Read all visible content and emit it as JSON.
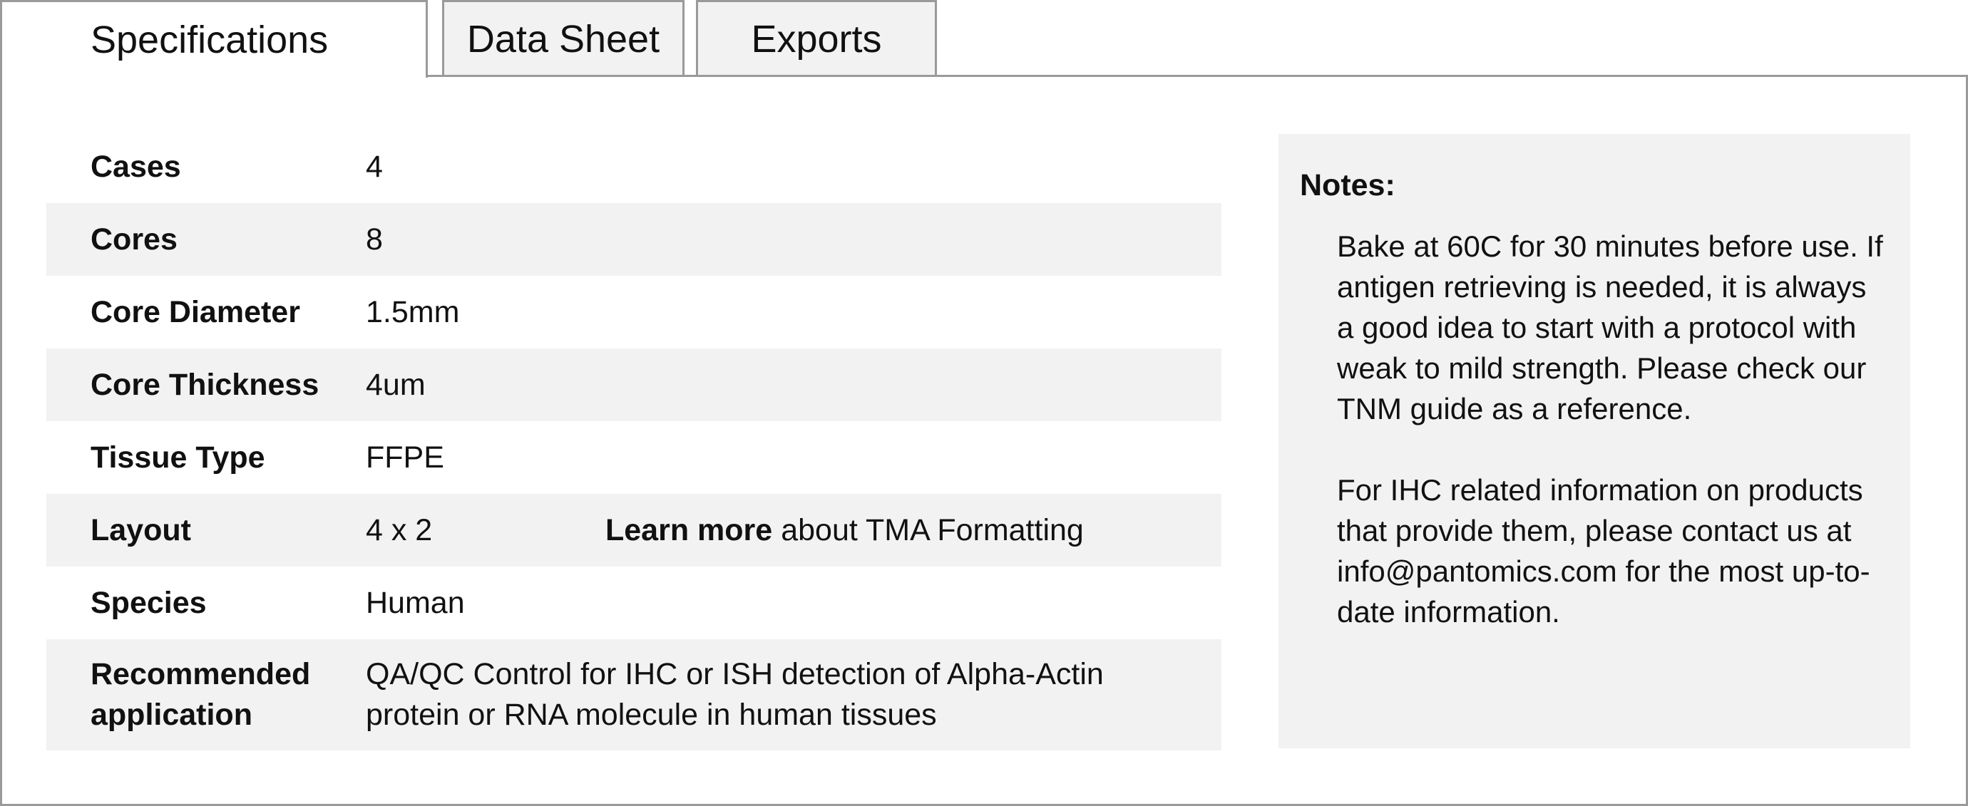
{
  "tabs": [
    {
      "label": "Specifications",
      "active": true
    },
    {
      "label": "Data Sheet",
      "active": false
    },
    {
      "label": "Exports",
      "active": false
    }
  ],
  "specs": {
    "rows": [
      {
        "label": "Cases",
        "value": "4"
      },
      {
        "label": "Cores",
        "value": "8"
      },
      {
        "label": "Core Diameter",
        "value": "1.5mm"
      },
      {
        "label": "Core Thickness",
        "value": "4um"
      },
      {
        "label": "Tissue Type",
        "value": "FFPE"
      },
      {
        "label": "Layout",
        "value": "4 x 2",
        "link_text": "Learn more",
        "link_suffix": "about TMA Formatting"
      },
      {
        "label": "Species",
        "value": "Human"
      },
      {
        "label": "Recommended application",
        "value": "QA/QC Control for IHC or ISH detection of Alpha-Actin protein or RNA molecule in human tissues"
      }
    ]
  },
  "notes": {
    "title": "Notes:",
    "paragraphs": [
      "Bake at 60C for 30 minutes before use. If antigen retrieving is needed, it is always a good idea to start with a protocol with weak to mild strength. Please check our TNM guide as a reference.",
      "For IHC related information on products that provide them, please contact us at info@pantomics.com for the most up-to-date information."
    ]
  },
  "colors": {
    "border": "#9a9a9a",
    "row_alt": "#f2f2f2",
    "notes_bg": "#f2f2f2",
    "text": "#111111"
  }
}
